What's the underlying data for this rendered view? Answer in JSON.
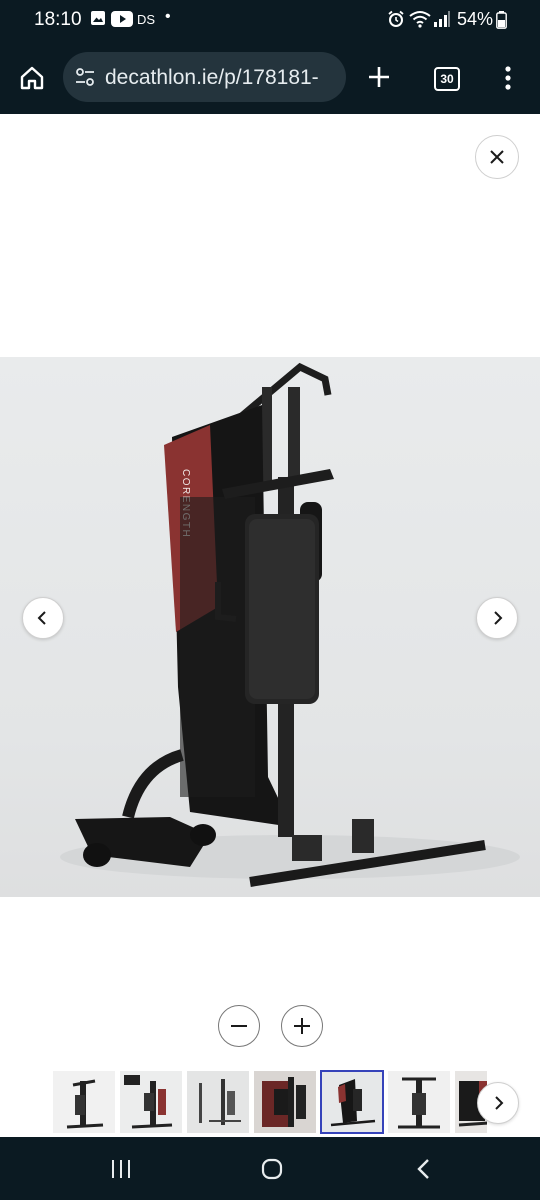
{
  "status_bar": {
    "time": "18:10",
    "carrier_label": "DS",
    "battery": "54%",
    "icons": [
      "gallery-icon",
      "youtube-icon",
      "alarm-icon",
      "wifi-icon",
      "signal-icon",
      "battery-icon"
    ]
  },
  "browser": {
    "url": "decathlon.ie/p/178181-",
    "tab_count": "30",
    "icons": [
      "home-icon",
      "site-settings-icon",
      "new-tab-plus-icon",
      "overflow-menu-icon"
    ]
  },
  "viewer": {
    "image_alt": "Home gym multi-station with black padded seat and red CORENGTH backrest panel",
    "brand_print": "CORENGTH",
    "thumbnail_count": 7,
    "selected_thumbnail": 5,
    "icons": [
      "close-icon",
      "chevron-left-icon",
      "chevron-right-icon",
      "zoom-out-icon",
      "zoom-in-icon"
    ]
  },
  "system_nav": {
    "icons": [
      "recents-icon",
      "home-circle-icon",
      "back-icon"
    ]
  },
  "colors": {
    "chrome_bg": "#0b1a22",
    "url_pill": "#24343d",
    "accent_red": "#8a3331",
    "selected_border": "#3643ba"
  }
}
